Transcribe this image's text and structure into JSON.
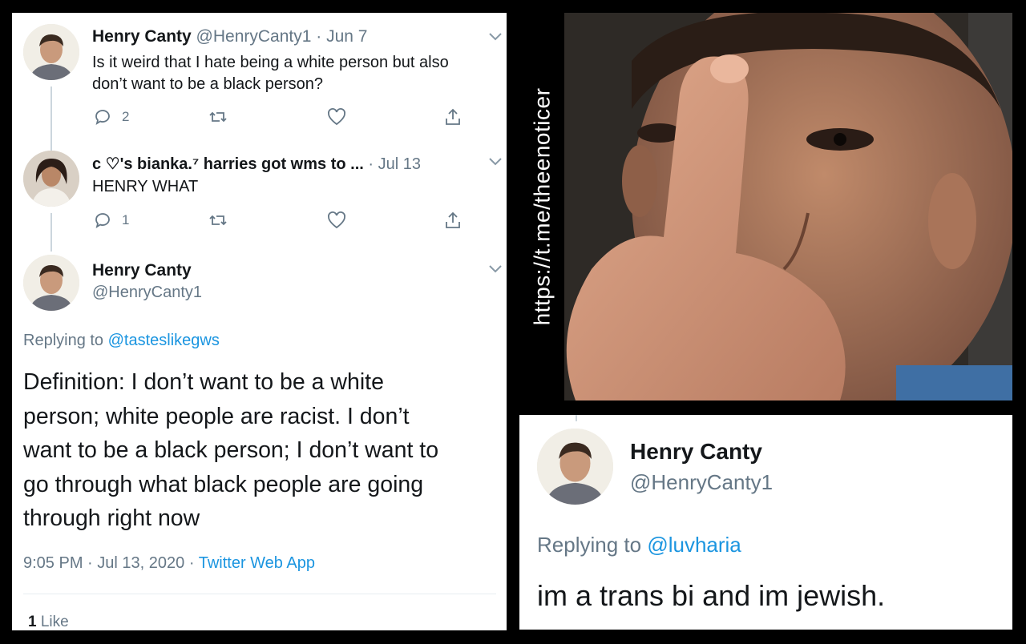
{
  "tweet1": {
    "name": "Henry Canty",
    "handle": "@HenryCanty1",
    "sep": "·",
    "date": "Jun 7",
    "text_line1": "Is it weird that I hate being a white person but also",
    "text_line2": "don’t want to be a black person?",
    "reply_count": "2"
  },
  "tweet2": {
    "name": "c ♡'s bianka.⁷ harries got wms to ...",
    "sep": "·",
    "date": "Jul 13",
    "text": "HENRY WHAT",
    "reply_count": "1"
  },
  "main_tweet": {
    "name": "Henry Canty",
    "handle": "@HenryCanty1",
    "replying_prefix": "Replying to",
    "replying_to": "@tasteslikegws",
    "lines": [
      "Definition: I don’t want to be a white",
      "person; white people are racist. I don’t",
      "want to be a black person; I don’t want to",
      "go through what black people are going",
      "through right now"
    ],
    "time": "9:05 PM",
    "sep": "·",
    "date": "Jul 13, 2020",
    "source": "Twitter Web App",
    "likes_count": "1",
    "likes_label": "Like"
  },
  "photo": {
    "watermark": "https://t.me/theenoticer"
  },
  "reply_tweet": {
    "name": "Henry Canty",
    "handle": "@HenryCanty1",
    "replying_prefix": "Replying to",
    "replying_to": "@luvharia",
    "text": "im a trans bi and im jewish."
  },
  "colors": {
    "link": "#1b95e0",
    "muted": "#657786",
    "text": "#14171a",
    "background": "#000000"
  },
  "icons": [
    "reply-icon",
    "retweet-icon",
    "like-icon",
    "share-icon",
    "chevron-down-icon"
  ]
}
